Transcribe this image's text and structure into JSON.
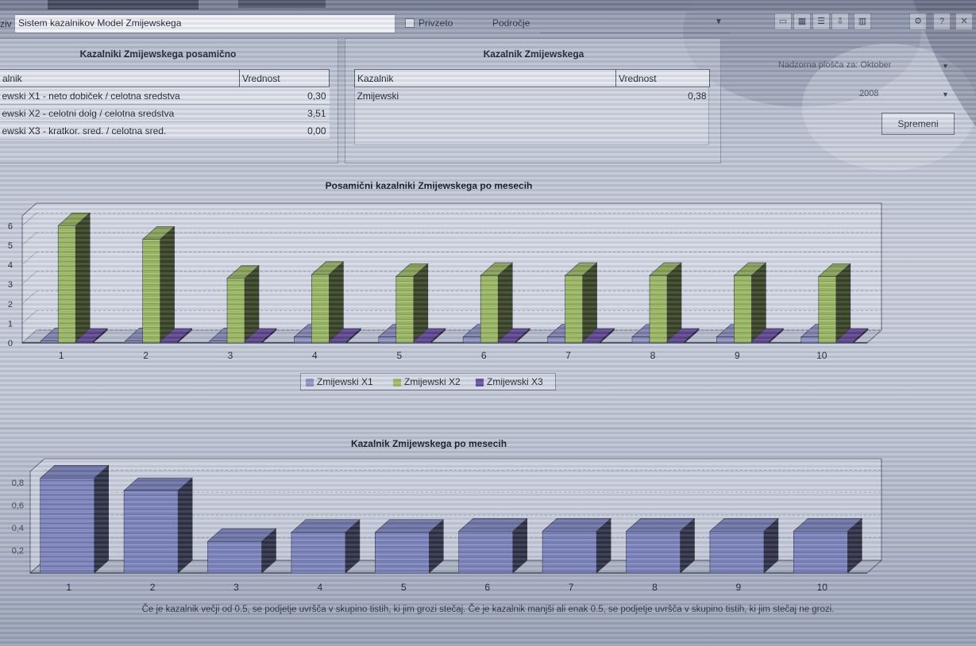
{
  "header": {
    "naziv_label": "ziv",
    "naziv_value": "Sistem kazalnikov Model Zmijewskega",
    "privzeto_label": "Privzeto",
    "podrocje_label": "Področje"
  },
  "toolbar": {
    "help_label": "?"
  },
  "left_panel": {
    "title": "Kazalniki Zmijewskega posamično",
    "col1": "alnik",
    "col2": "Vrednost",
    "rows": [
      {
        "name": "ewski X1 - neto dobiček / celotna sredstva",
        "value": "0,30"
      },
      {
        "name": "ewski X2 - celotni dolg / celotna sredstva",
        "value": "3,51"
      },
      {
        "name": "ewski X3 - kratkor. sred. / celotna sred.",
        "value": "0,00"
      }
    ]
  },
  "mid_panel": {
    "title": "Kazalnik Zmijewskega",
    "col1": "Kazalnik",
    "col2": "Vrednost",
    "rows": [
      {
        "name": "Zmijewski",
        "value": "0,38"
      }
    ]
  },
  "right_panel": {
    "period_label": "Nadzorna plošča za: Oktober",
    "year_value": "2008",
    "button_label": "Spremeni"
  },
  "footnote": "Če je kazalnik večji od 0.5, se podjetje uvršča v skupino tistih, ki jim grozi stečaj. Če je kazalnik manjši ali enak 0.5, se podjetje uvršča v skupino tistih, ki jim stečaj ne grozi.",
  "colors": {
    "x1": "#8f93c4",
    "x2": "#9dbb63",
    "x3": "#6b4fa6",
    "z": "#7e86c0"
  },
  "chart_data": [
    {
      "type": "bar",
      "title": "Posamični kazalniki Zmijewskega po mesecih",
      "categories": [
        "1",
        "2",
        "3",
        "4",
        "5",
        "6",
        "7",
        "8",
        "9",
        "10"
      ],
      "yticks": [
        "0",
        "1",
        "2",
        "3",
        "4",
        "5",
        "6"
      ],
      "ylim": [
        0,
        6.5
      ],
      "legend_position": "bottom",
      "series": [
        {
          "name": "Zmijewski X1",
          "values": [
            0.1,
            0.1,
            0.1,
            0.3,
            0.3,
            0.3,
            0.3,
            0.3,
            0.3,
            0.3
          ]
        },
        {
          "name": "Zmijewski X2",
          "values": [
            6.0,
            5.3,
            3.3,
            3.5,
            3.4,
            3.45,
            3.45,
            3.45,
            3.45,
            3.4
          ]
        },
        {
          "name": "Zmijewski X3",
          "values": [
            0.05,
            0.05,
            0.05,
            0.05,
            0.05,
            0.05,
            0.05,
            0.05,
            0.05,
            0.05
          ]
        }
      ]
    },
    {
      "type": "bar",
      "title": "Kazalnik Zmijewskega po mesecih",
      "categories": [
        "1",
        "2",
        "3",
        "4",
        "5",
        "6",
        "7",
        "8",
        "9",
        "10"
      ],
      "yticks": [
        "0,2",
        "0,4",
        "0,6",
        "0,8"
      ],
      "ylim": [
        0,
        0.9
      ],
      "series": [
        {
          "values": [
            0.84,
            0.73,
            0.28,
            0.36,
            0.36,
            0.37,
            0.37,
            0.37,
            0.37,
            0.37
          ]
        }
      ]
    }
  ]
}
